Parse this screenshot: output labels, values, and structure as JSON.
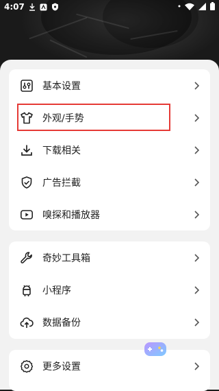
{
  "status": {
    "time": "4:07"
  },
  "groups": [
    {
      "items": [
        {
          "label": "基本设置",
          "icon": "sliders-icon"
        },
        {
          "label": "外观/手势",
          "icon": "tshirt-icon",
          "highlighted": true
        },
        {
          "label": "下载相关",
          "icon": "download-icon"
        },
        {
          "label": "广告拦截",
          "icon": "shield-check-icon"
        },
        {
          "label": "嗅探和播放器",
          "icon": "play-box-icon"
        }
      ]
    },
    {
      "items": [
        {
          "label": "奇妙工具箱",
          "icon": "wrench-icon"
        },
        {
          "label": "小程序",
          "icon": "android-icon"
        },
        {
          "label": "数据备份",
          "icon": "cloud-upload-icon"
        }
      ]
    },
    {
      "items": [
        {
          "label": "更多设置",
          "icon": "gear-icon"
        }
      ]
    }
  ],
  "colors": {
    "highlight": "#e53935",
    "sheet": "#f2f2f2",
    "card": "#ffffff"
  }
}
